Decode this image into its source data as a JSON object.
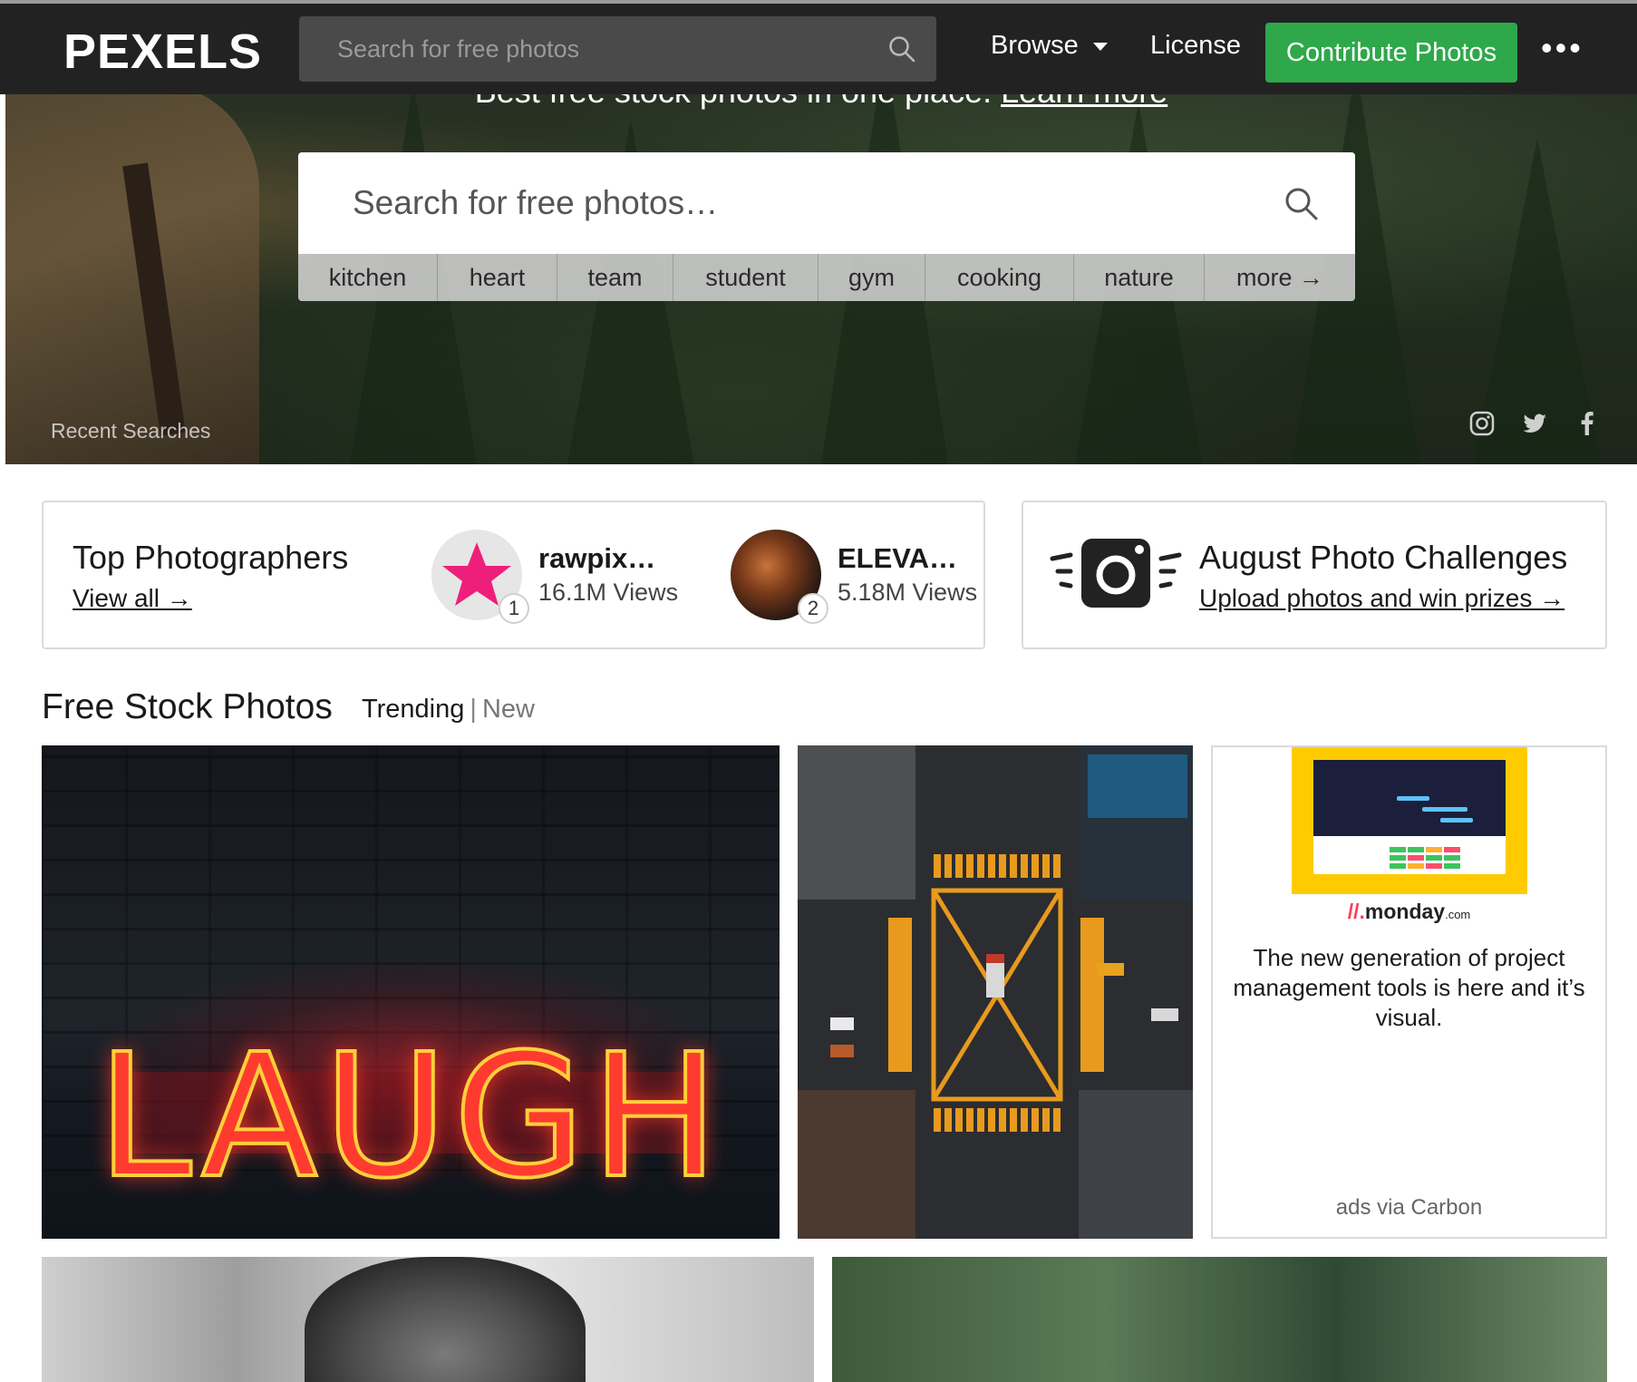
{
  "nav": {
    "logo": "PEXELS",
    "search_placeholder": "Search for free photos",
    "browse_label": "Browse",
    "license_label": "License",
    "contribute_label": "Contribute Photos",
    "more_label": "•••"
  },
  "hero": {
    "tagline_text": "Best free stock photos in one place.",
    "tagline_link": "Learn more",
    "search_placeholder": "Search for free photos…",
    "tags": [
      "kitchen",
      "heart",
      "team",
      "student",
      "gym",
      "cooking",
      "nature",
      "more →"
    ],
    "recent_searches_label": "Recent Searches",
    "social_icons": [
      "instagram-icon",
      "twitter-icon",
      "facebook-icon"
    ]
  },
  "top_photographers": {
    "title": "Top Photographers",
    "view_all": "View all →",
    "items": [
      {
        "name": "rawpix…",
        "views": "16.1M Views",
        "rank": "1"
      },
      {
        "name": "ELEVA…",
        "views": "5.18M Views",
        "rank": "2"
      }
    ]
  },
  "challenges": {
    "title": "August Photo Challenges",
    "link": "Upload photos and win prizes →"
  },
  "section": {
    "title": "Free Stock Photos",
    "tab_trending": "Trending",
    "tab_separator": "|",
    "tab_new": "New"
  },
  "photos": {
    "laugh_text": "LAUGH"
  },
  "ad": {
    "brand": "monday",
    "brand_suffix": ".com",
    "copy": "The new generation of project management tools is here and it’s visual.",
    "via": "ads via Carbon"
  },
  "colors": {
    "topbar": "#222222",
    "contribute": "#2ea84a",
    "ad_yellow": "#ffcb00",
    "star_pink": "#ee1f7a"
  }
}
